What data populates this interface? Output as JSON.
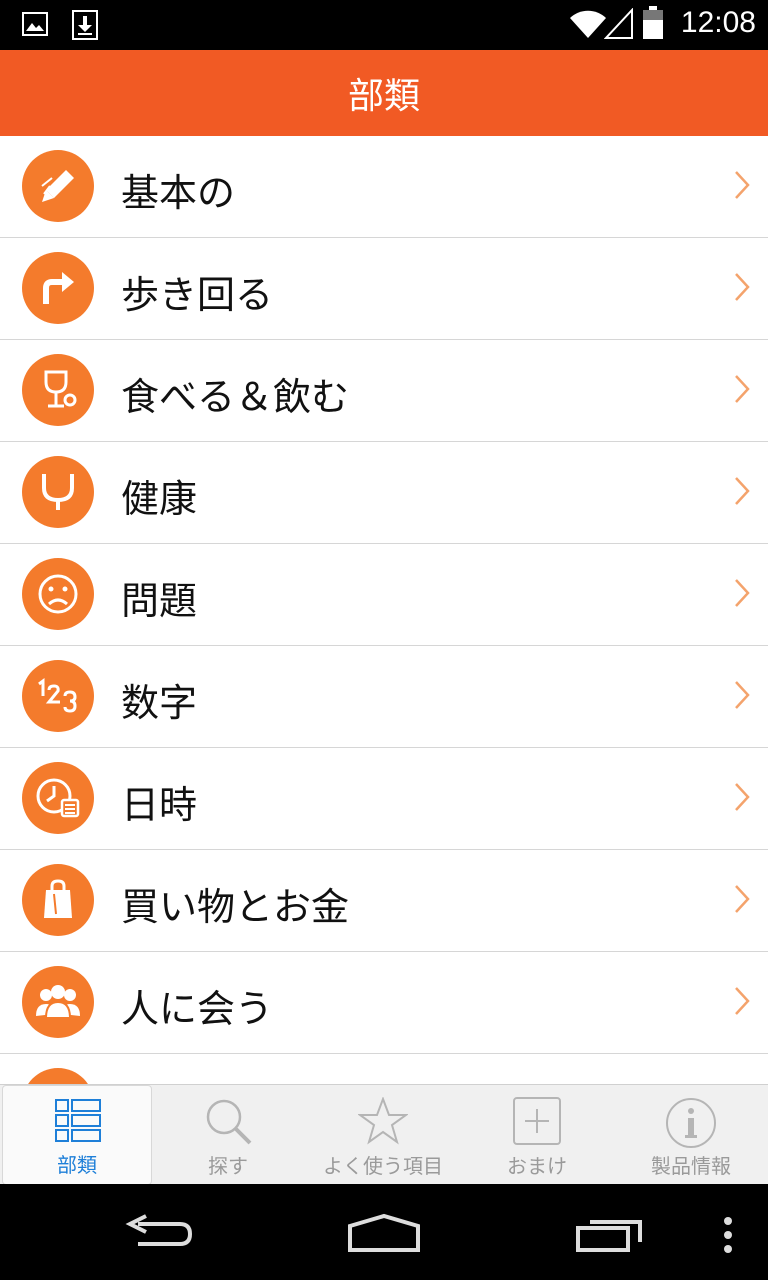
{
  "status_bar": {
    "time": "12:08"
  },
  "header": {
    "title": "部類"
  },
  "categories": [
    {
      "label": "基本の",
      "icon": "pencil-icon"
    },
    {
      "label": "歩き回る",
      "icon": "turn-right-arrow-icon"
    },
    {
      "label": "食べる＆飲む",
      "icon": "glass-icon"
    },
    {
      "label": "健康",
      "icon": "stethoscope-icon"
    },
    {
      "label": "問題",
      "icon": "sad-face-icon"
    },
    {
      "label": "数字",
      "icon": "numbers-icon"
    },
    {
      "label": "日時",
      "icon": "clock-icon"
    },
    {
      "label": "買い物とお金",
      "icon": "shopping-bag-icon"
    },
    {
      "label": "人に会う",
      "icon": "people-icon"
    }
  ],
  "tabs": [
    {
      "label": "部類",
      "icon": "list-icon",
      "active": true
    },
    {
      "label": "探す",
      "icon": "search-icon"
    },
    {
      "label": "よく使う項目",
      "icon": "star-icon"
    },
    {
      "label": "おまけ",
      "icon": "plus-box-icon"
    },
    {
      "label": "製品情報",
      "icon": "info-icon"
    }
  ],
  "colors": {
    "accent": "#f15a24",
    "icon_bg": "#f47b2c",
    "tab_active": "#1e7fd8"
  }
}
